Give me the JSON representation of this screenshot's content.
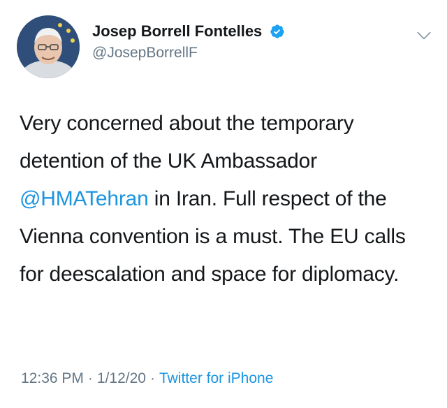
{
  "user": {
    "display_name": "Josep Borrell Fontelles",
    "handle": "@JosepBorrellF",
    "verified": true
  },
  "tweet": {
    "text_parts": [
      "Very concerned about the temporary detention of the UK Ambassador ",
      "@HMATehran",
      " in Iran. Full respect of the Vienna convention is a must. The EU calls for deescalation and space for diplomacy."
    ],
    "mention": "@HMATehran",
    "time": "12:36 PM",
    "date": "1/12/20",
    "source": "Twitter for iPhone",
    "separator": "·"
  },
  "colors": {
    "link": "#1b95e0",
    "verified_badge": "#1da1f2",
    "secondary_text": "#657786"
  },
  "icons": {
    "verified": "verified-badge-icon",
    "menu": "chevron-down-icon"
  }
}
